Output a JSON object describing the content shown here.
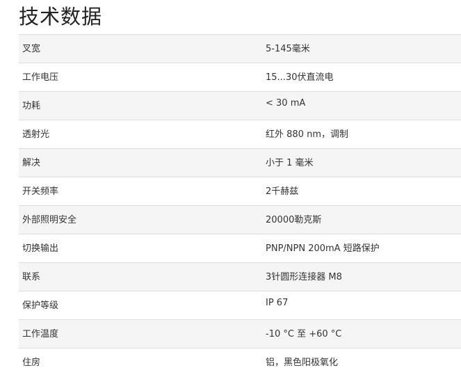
{
  "page": {
    "title": "技术数据"
  },
  "specs": [
    {
      "label": "叉宽",
      "value": "5-145毫米"
    },
    {
      "label": "工作电压",
      "value": "15...30伏直流电"
    },
    {
      "label": "功耗",
      "value": "< 30 mA"
    },
    {
      "label": "透射光",
      "value": "红外 880 nm，调制"
    },
    {
      "label": "解决",
      "value": "小于 1 毫米"
    },
    {
      "label": "开关频率",
      "value": "2千赫兹"
    },
    {
      "label": "外部照明安全",
      "value": "20000勒克斯"
    },
    {
      "label": "切换输出",
      "value": "PNP/NPN 200mA 短路保护"
    },
    {
      "label": "联系",
      "value": "3针圆形连接器 M8"
    },
    {
      "label": "保护等级",
      "value": "IP 67"
    },
    {
      "label": "工作温度",
      "value": "-10 °C 至 +60 °C"
    },
    {
      "label": "住房",
      "value": "铝，黑色阳极氧化"
    }
  ],
  "colors": {
    "row_odd": "#f5f5f5",
    "row_even": "#ffffff",
    "border": "#dddddd",
    "text": "#333333"
  }
}
